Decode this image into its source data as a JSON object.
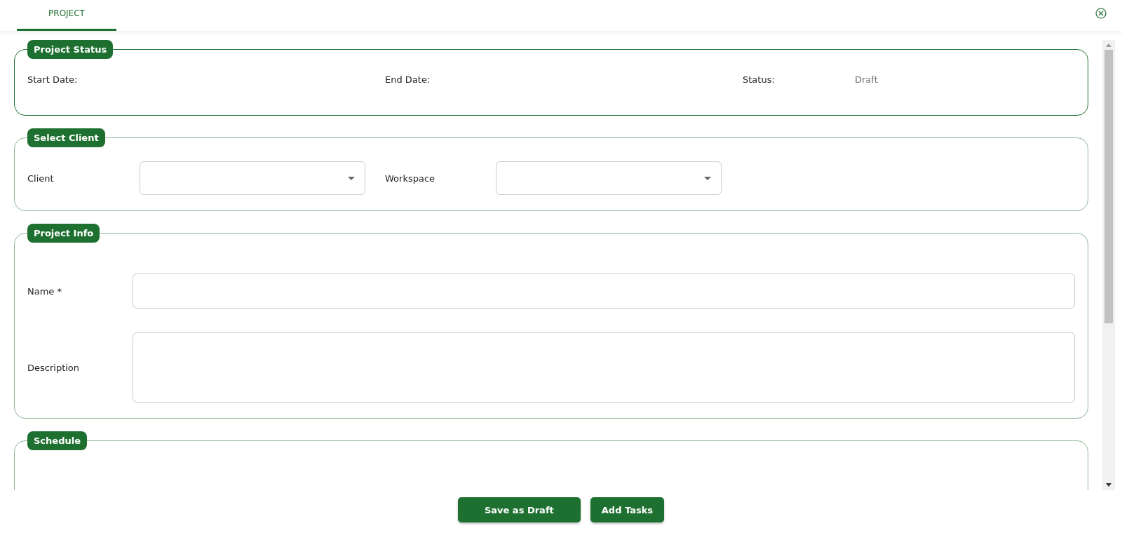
{
  "tabs": [
    {
      "label": "PROJECT",
      "selected": true
    }
  ],
  "sections": [
    {
      "kind": "status",
      "title": "Project Status",
      "fields": [
        {
          "label": "Start Date:"
        },
        {
          "label": "End Date:"
        },
        {
          "label": "Status:",
          "value": "Draft"
        }
      ]
    },
    {
      "kind": "selects",
      "title": "Select Client",
      "fields": [
        {
          "label": "Client"
        },
        {
          "label": "Workspace"
        }
      ]
    },
    {
      "kind": "inputs",
      "title": "Project Info",
      "fields": [
        {
          "label": "Name *",
          "kind": "input"
        },
        {
          "label": "Description",
          "kind": "textarea"
        }
      ]
    },
    {
      "kind": "empty",
      "title": "Schedule"
    }
  ],
  "buttons": [
    "Save as Draft",
    "Add Tasks"
  ]
}
